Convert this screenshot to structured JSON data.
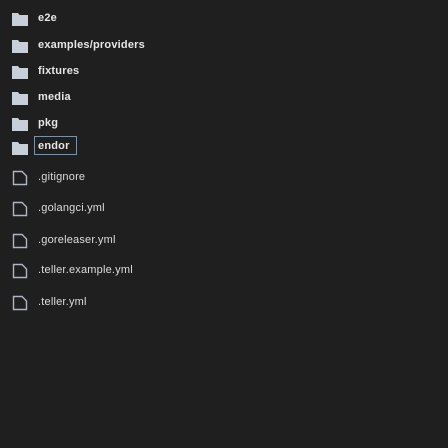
{
  "file_tree": {
    "items": [
      {
        "label": "e2e",
        "kind": "folder"
      },
      {
        "label": "examples/providers",
        "kind": "folder"
      },
      {
        "label": "fixtures",
        "kind": "folder"
      },
      {
        "label": "media",
        "kind": "folder"
      },
      {
        "label": "pkg",
        "kind": "folder"
      },
      {
        "label": "vendor",
        "kind": "folder"
      },
      {
        "label": ".gitignore",
        "kind": "file"
      },
      {
        "label": ".golangci.yml",
        "kind": "file"
      },
      {
        "label": ".goreleaser.yml",
        "kind": "file"
      },
      {
        "label": ".teller.example.yml",
        "kind": "file"
      },
      {
        "label": ".teller.yml",
        "kind": "file"
      }
    ],
    "visible_vendor_text": "endor"
  },
  "colors": {
    "background": "#1f1f1f",
    "folder_icon": "#c9cfd8",
    "file_icon_stroke": "#aeb6c4",
    "text": "#dcdcdc",
    "selection_border": "#7f8fa8"
  },
  "icons": {
    "folder": "folder-icon",
    "file": "file-icon"
  }
}
